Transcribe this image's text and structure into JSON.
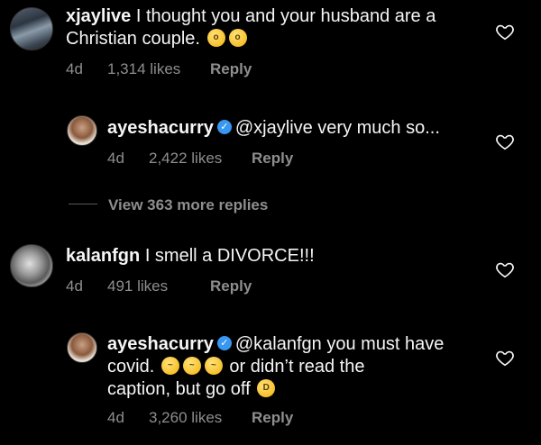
{
  "comments": [
    {
      "username": "xjaylive",
      "text_line1": "I thought you and your husband are a",
      "text_line2": "Christian couple.",
      "time": "4d",
      "likes": "1,314 likes",
      "reply": "Reply",
      "emojis": [
        "hushed-face-emoji",
        "hushed-face-emoji"
      ]
    },
    {
      "username": "ayeshacurry",
      "verified": true,
      "text": "@xjaylive very much so...",
      "time": "4d",
      "likes": "2,422 likes",
      "reply": "Reply"
    },
    {
      "username": "kalanfgn",
      "text": "I smell a DIVORCE!!!",
      "time": "4d",
      "likes": "491 likes",
      "reply": "Reply"
    },
    {
      "username": "ayeshacurry",
      "verified": true,
      "text_line1": "@kalanfgn you must have",
      "text_line2a": "covid.",
      "text_line2b": "or didn’t read the",
      "text_line3": "caption, but go off",
      "time": "4d",
      "likes": "3,260 likes",
      "reply": "Reply",
      "emojis": [
        "woozy-face-emoji",
        "woozy-face-emoji",
        "woozy-face-emoji",
        "rofl-emoji"
      ]
    }
  ],
  "view_more": "View 363 more replies",
  "colors": {
    "background": "#000000",
    "text": "#f5f5f5",
    "muted": "#8e8e8e",
    "verified": "#3897f0"
  }
}
